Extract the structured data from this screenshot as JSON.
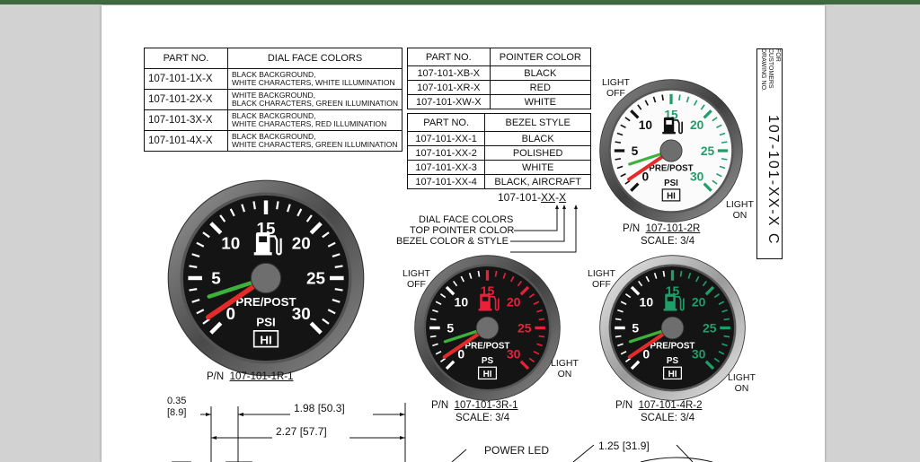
{
  "dial_table": {
    "headers": [
      "PART NO.",
      "DIAL FACE COLORS"
    ],
    "rows": [
      {
        "part": "107-101-1X-X",
        "l1": "BLACK BACKGROUND,",
        "l2": "WHITE CHARACTERS, WHITE ILLUMINATION"
      },
      {
        "part": "107-101-2X-X",
        "l1": "WHITE BACKGROUND,",
        "l2": "BLACK CHARACTERS, GREEN ILLUMINATION"
      },
      {
        "part": "107-101-3X-X",
        "l1": "BLACK BACKGROUND,",
        "l2": "WHITE CHARACTERS, RED ILLUMINATION"
      },
      {
        "part": "107-101-4X-X",
        "l1": "BLACK BACKGROUND,",
        "l2": "WHITE CHARACTERS, GREEN ILLUMINATION"
      }
    ]
  },
  "pointer_table": {
    "headers": [
      "PART NO.",
      "POINTER COLOR"
    ],
    "rows": [
      {
        "part": "107-101-XB-X",
        "value": "BLACK"
      },
      {
        "part": "107-101-XR-X",
        "value": "RED"
      },
      {
        "part": "107-101-XW-X",
        "value": "WHITE"
      }
    ]
  },
  "bezel_table": {
    "headers": [
      "PART NO.",
      "BEZEL STYLE"
    ],
    "rows": [
      {
        "part": "107-101-XX-1",
        "value": "BLACK"
      },
      {
        "part": "107-101-XX-2",
        "value": "POLISHED"
      },
      {
        "part": "107-101-XX-3",
        "value": "WHITE"
      },
      {
        "part": "107-101-XX-4",
        "value": "BLACK, AIRCRAFT"
      }
    ]
  },
  "code": {
    "prefix": "107-101-",
    "xx": "XX",
    "dash": "-",
    "x": "X",
    "callouts": [
      "DIAL FACE COLORS",
      "TOP POINTER COLOR",
      "BEZEL COLOR & STYLE"
    ]
  },
  "gauge_text": {
    "ticks": [
      "5",
      "10",
      "15",
      "20",
      "25",
      "30"
    ],
    "zero": "0",
    "brand": "PRE/POST",
    "unit_full": "PSI",
    "unit_short": "PS",
    "hi": "HI"
  },
  "gauges": [
    {
      "pn_prefix": "P/N",
      "pn": "107-101-1R-1",
      "scale": "",
      "light_off": "",
      "light_on": ""
    },
    {
      "pn_prefix": "P/N",
      "pn": "107-101-2R",
      "scale": "SCALE: 3/4",
      "light_off": "LIGHT\nOFF",
      "light_on": "LIGHT\nON"
    },
    {
      "pn_prefix": "P/N",
      "pn": "107-101-3R-1",
      "scale": "SCALE: 3/4",
      "light_off": "LIGHT\nOFF",
      "light_on": "LIGHT\nON"
    },
    {
      "pn_prefix": "P/N",
      "pn": "107-101-4R-2",
      "scale": "SCALE: 3/4",
      "light_off": "LIGHT\nOFF",
      "light_on": "LIGHT\nON"
    }
  ],
  "title_block": {
    "note": "FOR CUSTOMERS DRAWING NO.",
    "number": "107-101-XX-X C"
  },
  "dimensions": {
    "d1": "0.35",
    "d1_mm": "[8.9]",
    "d2": "1.98 [50.3]",
    "d3": "2.27 [57.7]",
    "power_led": "POWER LED",
    "d4": "1.25 [31.9]"
  },
  "colors": {
    "frame_green": "#3d6b3f",
    "red_illum": "#e8203a",
    "green_illum": "#1f9e6a",
    "needle_red": "#e52a2a",
    "needle_green": "#3cb13c"
  }
}
